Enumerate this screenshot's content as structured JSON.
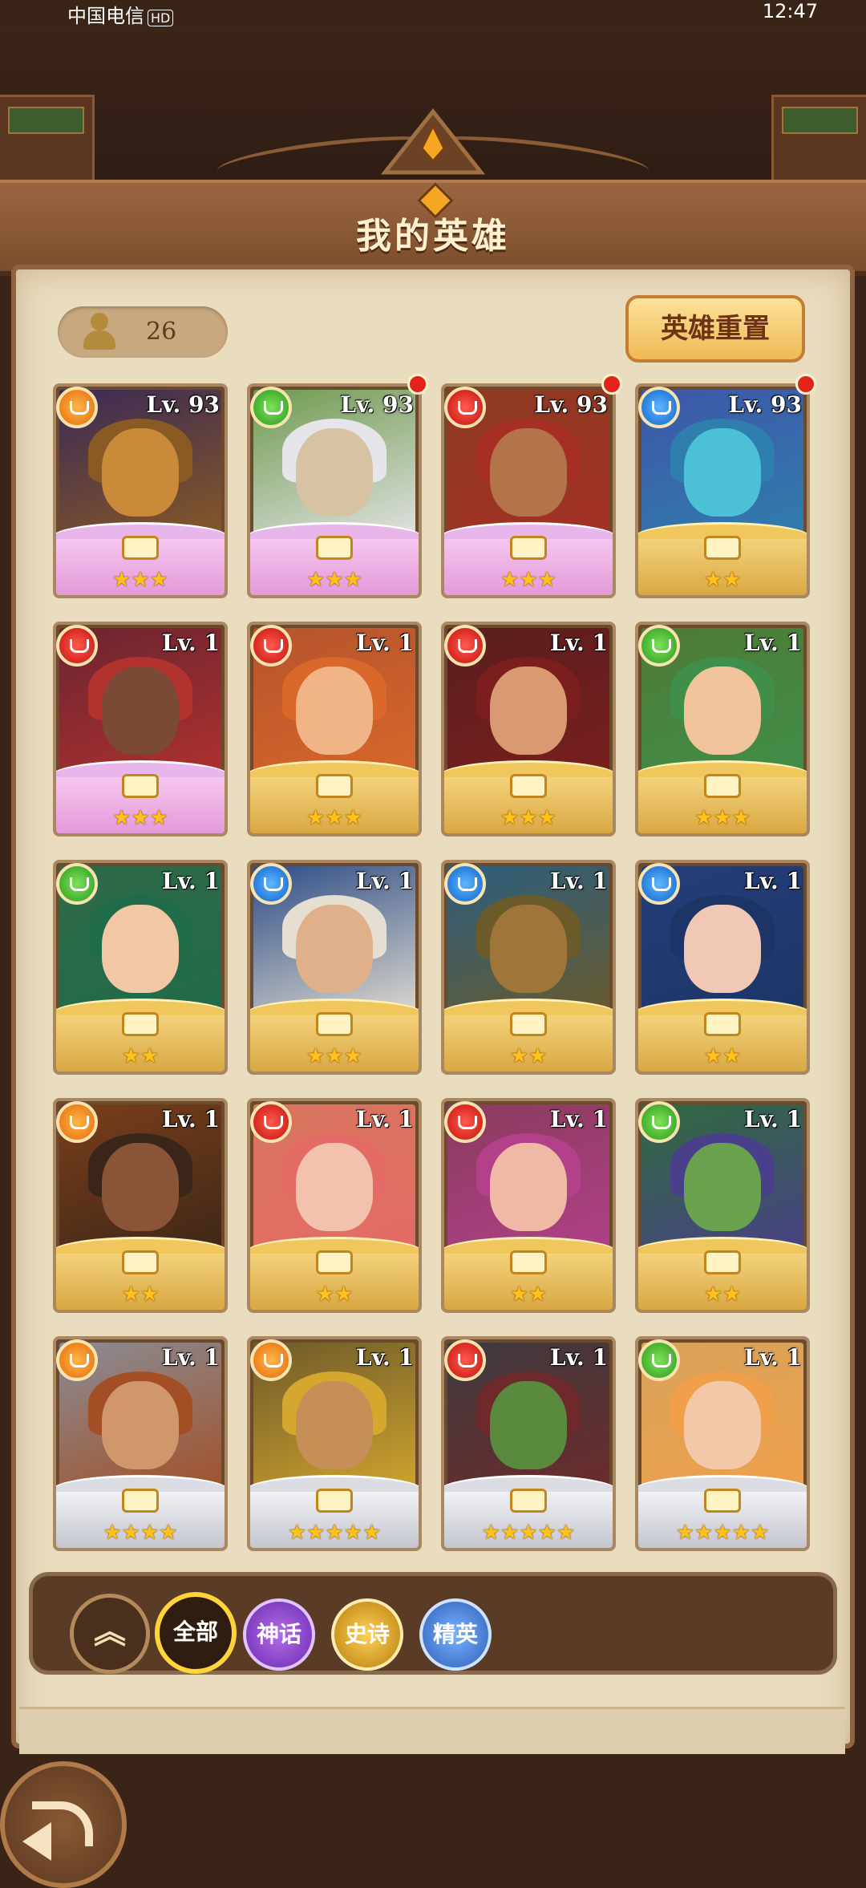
{
  "status_bar": {
    "carrier": "中国电信",
    "hd": "HD",
    "right_text": "12:47"
  },
  "header": {
    "title": "我的英雄"
  },
  "hero_count": "26",
  "reset_button": "英雄重置",
  "heroes": [
    {
      "level": "Lv. 93",
      "element": "orange",
      "frame": "pink",
      "stars": "★★★",
      "red_dot": false,
      "art": [
        "#3b2a55",
        "#c98b3a",
        "#8a5a24"
      ]
    },
    {
      "level": "Lv. 93",
      "element": "green",
      "frame": "pink",
      "stars": "★★★",
      "red_dot": true,
      "art": [
        "#6f9a4e",
        "#d8c2a4",
        "#e6e6ea"
      ]
    },
    {
      "level": "Lv. 93",
      "element": "red",
      "frame": "pink",
      "stars": "★★★",
      "red_dot": true,
      "art": [
        "#8c3b22",
        "#b47449",
        "#a52f24"
      ]
    },
    {
      "level": "Lv. 93",
      "element": "blue",
      "frame": "gold",
      "stars": "★★",
      "red_dot": true,
      "art": [
        "#3e56a8",
        "#4cc1d6",
        "#2f7fae"
      ]
    },
    {
      "level": "Lv. 1",
      "element": "red",
      "frame": "pink",
      "stars": "★★★",
      "red_dot": false,
      "art": [
        "#6b2430",
        "#7a4a36",
        "#b1322f"
      ]
    },
    {
      "level": "Lv. 1",
      "element": "red",
      "frame": "gold",
      "stars": "★★★",
      "red_dot": false,
      "art": [
        "#b5542c",
        "#f0b487",
        "#d9682a"
      ]
    },
    {
      "level": "Lv. 1",
      "element": "red",
      "frame": "gold",
      "stars": "★★★",
      "red_dot": false,
      "art": [
        "#5a1e1e",
        "#d99a72",
        "#7a1f1d"
      ]
    },
    {
      "level": "Lv. 1",
      "element": "green",
      "frame": "gold",
      "stars": "★★★",
      "red_dot": false,
      "art": [
        "#4f7a36",
        "#f0c39a",
        "#3f8f4a"
      ]
    },
    {
      "level": "Lv. 1",
      "element": "green",
      "frame": "gold",
      "stars": "★★",
      "red_dot": false,
      "art": [
        "#2f6a48",
        "#f2c7a6",
        "#1f6b4a"
      ]
    },
    {
      "level": "Lv. 1",
      "element": "blue",
      "frame": "gold",
      "stars": "★★★",
      "red_dot": false,
      "art": [
        "#2e4d86",
        "#e0b08a",
        "#e5dfd2"
      ]
    },
    {
      "level": "Lv. 1",
      "element": "blue",
      "frame": "gold",
      "stars": "★★",
      "red_dot": false,
      "art": [
        "#2c5e7e",
        "#a0753a",
        "#6b5a2a"
      ]
    },
    {
      "level": "Lv. 1",
      "element": "blue",
      "frame": "gold",
      "stars": "★★",
      "red_dot": false,
      "art": [
        "#253e7a",
        "#f1c8b6",
        "#1c3566"
      ]
    },
    {
      "level": "Lv. 1",
      "element": "orange",
      "frame": "gold",
      "stars": "★★",
      "red_dot": false,
      "art": [
        "#7a3e1a",
        "#8a5536",
        "#3a2618"
      ]
    },
    {
      "level": "Lv. 1",
      "element": "red",
      "frame": "gold",
      "stars": "★★",
      "red_dot": false,
      "art": [
        "#d8765e",
        "#f3c2ae",
        "#e46a66"
      ]
    },
    {
      "level": "Lv. 1",
      "element": "red",
      "frame": "gold",
      "stars": "★★",
      "red_dot": false,
      "art": [
        "#8a3b5c",
        "#f0b9a6",
        "#b2418a"
      ]
    },
    {
      "level": "Lv. 1",
      "element": "green",
      "frame": "gold",
      "stars": "★★",
      "red_dot": false,
      "art": [
        "#2f6a3e",
        "#6aa14e",
        "#4a3f8a"
      ]
    },
    {
      "level": "Lv. 1",
      "element": "orange",
      "frame": "silver",
      "stars": "★★★★",
      "red_dot": false,
      "art": [
        "#8a8c94",
        "#d0966c",
        "#a34e24"
      ]
    },
    {
      "level": "Lv. 1",
      "element": "orange",
      "frame": "silver",
      "stars": "★★★★★",
      "red_dot": false,
      "art": [
        "#6e5a2a",
        "#c68f58",
        "#d4a72e"
      ]
    },
    {
      "level": "Lv. 1",
      "element": "red",
      "frame": "silver",
      "stars": "★★★★★",
      "red_dot": false,
      "art": [
        "#3e3a3e",
        "#5a8a3e",
        "#6e2a2a"
      ]
    },
    {
      "level": "Lv. 1",
      "element": "green",
      "frame": "silver",
      "stars": "★★★★★",
      "red_dot": false,
      "art": [
        "#d8a25a",
        "#f3c8a8",
        "#f0a04a"
      ]
    }
  ],
  "filters": {
    "collapse": "︽",
    "all": "全部",
    "myth": "神话",
    "epic": "史诗",
    "elite": "精英"
  },
  "colors": {
    "background": "#3a2418",
    "parchment": "#e9dcbf",
    "title_bar": "#8a5a36",
    "star": "#ffc21a",
    "red_dot": "#e2231a"
  }
}
